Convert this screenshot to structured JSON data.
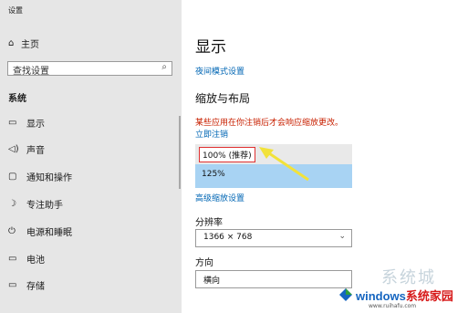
{
  "window": {
    "title": "设置"
  },
  "sidebar": {
    "home": {
      "icon": "home-icon",
      "label": "主页"
    },
    "search": {
      "placeholder": "查找设置",
      "icon": "search-icon"
    },
    "section_title": "系统",
    "items": [
      {
        "label": "显示",
        "icon": "monitor-icon"
      },
      {
        "label": "声音",
        "icon": "speaker-icon"
      },
      {
        "label": "通知和操作",
        "icon": "notification-icon"
      },
      {
        "label": "专注助手",
        "icon": "moon-icon"
      },
      {
        "label": "电源和睡眠",
        "icon": "power-icon"
      },
      {
        "label": "电池",
        "icon": "battery-icon"
      },
      {
        "label": "存储",
        "icon": "storage-icon"
      }
    ]
  },
  "main": {
    "title": "显示",
    "night_mode_link": "夜间模式设置",
    "scale_section": {
      "title": "缩放与布局",
      "warning": "某些应用在你注销后才会响应缩放更改。",
      "signout_link": "立即注销",
      "options": [
        "100% (推荐)",
        "125%"
      ],
      "selected_option": "125%",
      "advanced_link": "高级缩放设置"
    },
    "resolution": {
      "label": "分辨率",
      "value": "1366 × 768"
    },
    "orientation": {
      "label": "方向",
      "value": "横向"
    }
  },
  "watermark": {
    "text": "系统城",
    "brand_prefix": "windows",
    "brand_suffix": "系统家园",
    "url": "www.ruihafu.com"
  },
  "colors": {
    "sidebar_bg": "#e6e6e6",
    "link": "#0066b4",
    "warning": "#c82000",
    "selected_option": "#a8d3f3",
    "highlight_box": "#e03030",
    "arrow": "#f2e23a"
  }
}
